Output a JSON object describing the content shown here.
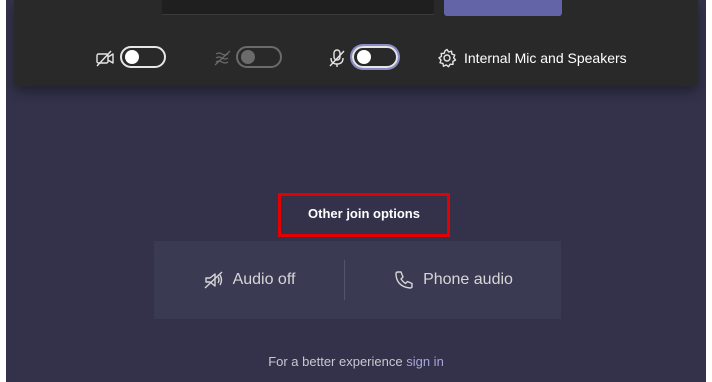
{
  "device_settings": {
    "label": "Internal Mic and Speakers",
    "icon": "gear-icon"
  },
  "toggles": {
    "camera": {
      "icon": "camera-off-icon",
      "state": "off"
    },
    "blur": {
      "icon": "background-blur-icon",
      "state": "disabled"
    },
    "mic": {
      "icon": "mic-off-icon",
      "state": "off"
    }
  },
  "other_join": {
    "label": "Other join options"
  },
  "options": {
    "audio_off": {
      "label": "Audio off",
      "icon": "speaker-off-icon"
    },
    "phone_audio": {
      "label": "Phone audio",
      "icon": "phone-icon"
    }
  },
  "footer": {
    "text": "For a better experience",
    "link": "sign in"
  },
  "colors": {
    "background": "#33324a",
    "panel": "#292929",
    "accent": "#6264a7",
    "highlight": "#e30000",
    "link": "#a6a7dc"
  }
}
